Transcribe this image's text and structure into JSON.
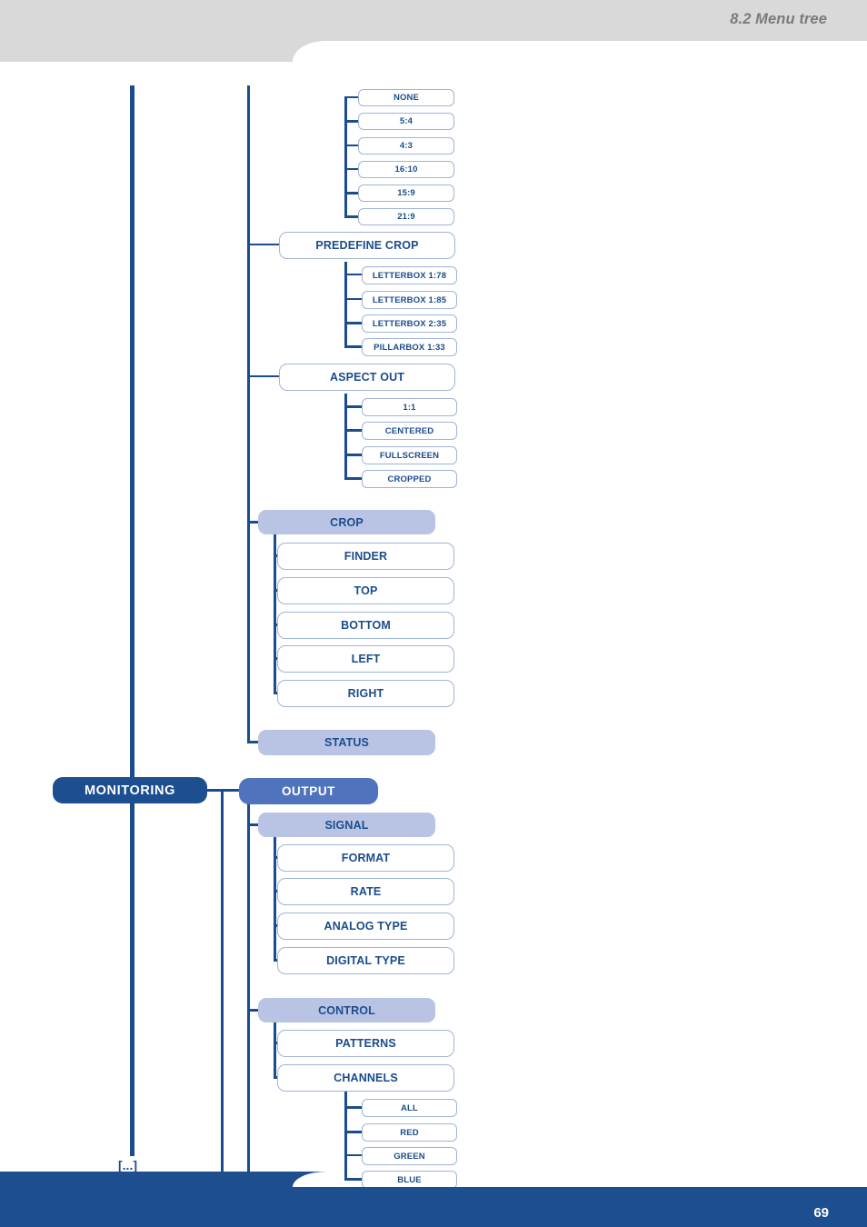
{
  "header": {
    "section_title": "8.2 Menu tree",
    "background_color": "#d9d9d9",
    "text_color": "#7b7b7b"
  },
  "footer": {
    "page_number": "69",
    "background_color": "#1d4e8f"
  },
  "theme": {
    "dark_blue": "#1d4e8f",
    "mid_blue": "#4f74bd",
    "lavender": "#b9c4e4",
    "line_blue": "#1b4c8c",
    "leaf_border": "#9fb4d6",
    "leaf_text": "#1b4c8c"
  },
  "tree": {
    "root": {
      "label": "MONITORING",
      "style": "root"
    },
    "continuation_marker": "[...]",
    "aspect_values": [
      {
        "label": "NONE"
      },
      {
        "label": "5:4"
      },
      {
        "label": "4:3"
      },
      {
        "label": "16:10"
      },
      {
        "label": "15:9"
      },
      {
        "label": "21:9"
      }
    ],
    "predefine_crop": {
      "label": "PREDEFINE CROP",
      "children": [
        {
          "label": "LETTERBOX 1:78"
        },
        {
          "label": "LETTERBOX 1:85"
        },
        {
          "label": "LETTERBOX 2:35"
        },
        {
          "label": "PILLARBOX 1:33"
        }
      ]
    },
    "aspect_out": {
      "label": "ASPECT OUT",
      "children": [
        {
          "label": "1:1"
        },
        {
          "label": "CENTERED"
        },
        {
          "label": "FULLSCREEN"
        },
        {
          "label": "CROPPED"
        }
      ]
    },
    "crop": {
      "label": "CROP",
      "children": [
        {
          "label": "FINDER"
        },
        {
          "label": "TOP"
        },
        {
          "label": "BOTTOM"
        },
        {
          "label": "LEFT"
        },
        {
          "label": "RIGHT"
        }
      ]
    },
    "status": {
      "label": "STATUS"
    },
    "output": {
      "label": "OUTPUT",
      "signal": {
        "label": "SIGNAL",
        "children": [
          {
            "label": "FORMAT"
          },
          {
            "label": "RATE"
          },
          {
            "label": "ANALOG TYPE"
          },
          {
            "label": "DIGITAL TYPE"
          }
        ]
      },
      "control": {
        "label": "CONTROL",
        "patterns": {
          "label": "PATTERNS"
        },
        "channels": {
          "label": "CHANNELS",
          "children": [
            {
              "label": "ALL"
            },
            {
              "label": "RED"
            },
            {
              "label": "GREEN"
            },
            {
              "label": "BLUE"
            }
          ]
        }
      }
    }
  }
}
